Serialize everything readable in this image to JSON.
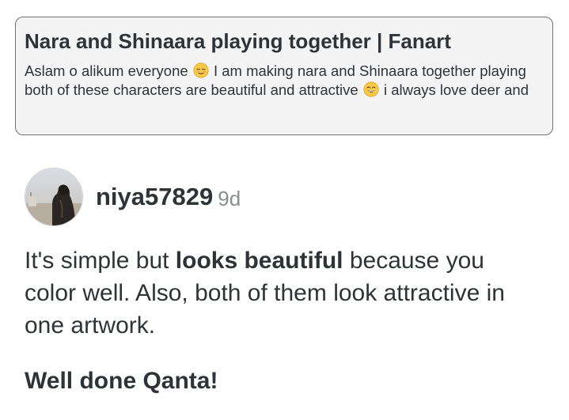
{
  "post": {
    "title": "Nara and Shinaara playing together | Fanart",
    "excerpt_part1": "Aslam o alikum everyone",
    "excerpt_emoji1": "relieved-face-icon",
    "excerpt_part2": "I am making nara and Shinaara together playing both of these characters are beautiful and attractive",
    "excerpt_emoji2": "grinning-face-icon",
    "excerpt_part3": "i always love deer and"
  },
  "comment": {
    "username": "niya57829",
    "timestamp": "9d",
    "body_part1": "It's simple but ",
    "body_bold": "looks beautiful",
    "body_part2": " because you color well. Also, both of them look attractive in one artwork.",
    "closing": "Well done Qanta!"
  },
  "colors": {
    "text": "#2f3338",
    "muted": "#8a8d91",
    "card_bg": "#f4f4f4",
    "card_border": "#6f7378",
    "emoji": "#f7c948"
  }
}
